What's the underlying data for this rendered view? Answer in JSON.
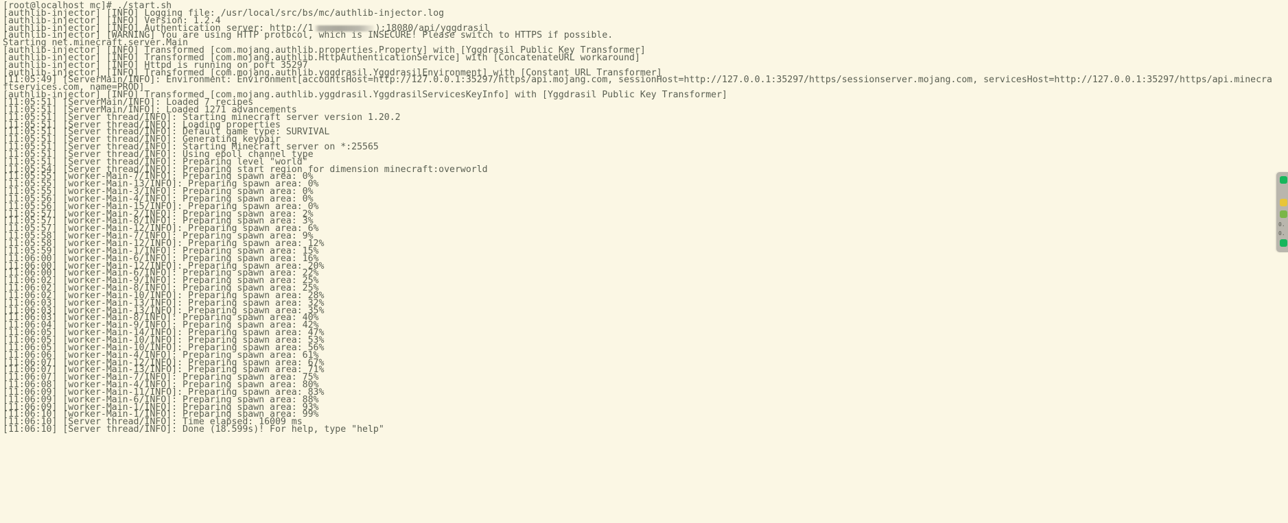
{
  "terminal": {
    "background_color": "#fbf7e4",
    "text_color": "#5a5f52",
    "prompt": "[root@localhost mc]# ./start.sh",
    "lines": [
      "[root@localhost mc]# ./start.sh",
      "[authlib-injector] [INFO] Logging file: /usr/local/src/bs/mc/authlib-injector.log",
      "[authlib-injector] [INFO] Version: 1.2.4",
      "__REDACTED_AUTH_LINE__",
      "[authlib-injector] [WARNING] You are using HTTP protocol, which is INSECURE! Please switch to HTTPS if possible.",
      "Starting net.minecraft.server.Main",
      "[authlib-injector] [INFO] Transformed [com.mojang.authlib.properties.Property] with [Yggdrasil Public Key Transformer]",
      "[authlib-injector] [INFO] Transformed [com.mojang.authlib.HttpAuthenticationService] with [ConcatenateURL workaround]",
      "[authlib-injector] [INFO] Httpd is running on port 35297",
      "[authlib-injector] [INFO] Transformed [com.mojang.authlib.yggdrasil.YggdrasilEnvironment] with [Constant URL Transformer]",
      "[11:05:49] [ServerMain/INFO]: Environment: Environment[accountsHost=http://127.0.0.1:35297/https/api.mojang.com, sessionHost=http://127.0.0.1:35297/https/sessionserver.mojang.com, servicesHost=http://127.0.0.1:35297/https/api.minecra",
      "ftservices.com, name=PROD]",
      "[authlib-injector] [INFO] Transformed [com.mojang.authlib.yggdrasil.YggdrasilServicesKeyInfo] with [Yggdrasil Public Key Transformer]",
      "[11:05:51] [ServerMain/INFO]: Loaded 7 recipes",
      "[11:05:51] [ServerMain/INFO]: Loaded 1271 advancements",
      "[11:05:51] [Server thread/INFO]: Starting minecraft server version 1.20.2",
      "[11:05:51] [Server thread/INFO]: Loading properties",
      "[11:05:51] [Server thread/INFO]: Default game type: SURVIVAL",
      "[11:05:51] [Server thread/INFO]: Generating keypair",
      "[11:05:51] [Server thread/INFO]: Starting Minecraft server on *:25565",
      "[11:05:51] [Server thread/INFO]: Using epoll channel type",
      "[11:05:51] [Server thread/INFO]: Preparing level \"world\"",
      "[11:05:54] [Server thread/INFO]: Preparing start region for dimension minecraft:overworld",
      "[11:05:55] [worker-Main-7/INFO]: Preparing spawn area: 0%",
      "[11:05:55] [worker-Main-13/INFO]: Preparing spawn area: 0%",
      "[11:05:55] [worker-Main-3/INFO]: Preparing spawn area: 0%",
      "[11:05:56] [worker-Main-4/INFO]: Preparing spawn area: 0%",
      "[11:05:56] [worker-Main-15/INFO]: Preparing spawn area: 0%",
      "[11:05:57] [worker-Main-2/INFO]: Preparing spawn area: 2%",
      "[11:05:57] [worker-Main-8/INFO]: Preparing spawn area: 3%",
      "[11:05:57] [worker-Main-12/INFO]: Preparing spawn area: 6%",
      "[11:05:58] [worker-Main-7/INFO]: Preparing spawn area: 9%",
      "[11:05:58] [worker-Main-12/INFO]: Preparing spawn area: 12%",
      "[11:05:59] [worker-Main-1/INFO]: Preparing spawn area: 15%",
      "[11:06:00] [worker-Main-6/INFO]: Preparing spawn area: 16%",
      "[11:06:00] [worker-Main-12/INFO]: Preparing spawn area: 20%",
      "[11:06:00] [worker-Main-6/INFO]: Preparing spawn area: 22%",
      "[11:06:02] [worker-Main-9/INFO]: Preparing spawn area: 25%",
      "[11:06:02] [worker-Main-8/INFO]: Preparing spawn area: 25%",
      "[11:06:02] [worker-Main-10/INFO]: Preparing spawn area: 28%",
      "[11:06:03] [worker-Main-13/INFO]: Preparing spawn area: 32%",
      "[11:06:03] [worker-Main-13/INFO]: Preparing spawn area: 35%",
      "[11:06:03] [worker-Main-8/INFO]: Preparing spawn area: 40%",
      "[11:06:04] [worker-Main-9/INFO]: Preparing spawn area: 42%",
      "[11:06:05] [worker-Main-14/INFO]: Preparing spawn area: 47%",
      "[11:06:05] [worker-Main-10/INFO]: Preparing spawn area: 53%",
      "[11:06:05] [worker-Main-10/INFO]: Preparing spawn area: 56%",
      "[11:06:06] [worker-Main-4/INFO]: Preparing spawn area: 61%",
      "[11:06:07] [worker-Main-12/INFO]: Preparing spawn area: 67%",
      "[11:06:07] [worker-Main-13/INFO]: Preparing spawn area: 71%",
      "[11:06:07] [worker-Main-7/INFO]: Preparing spawn area: 75%",
      "[11:06:08] [worker-Main-4/INFO]: Preparing spawn area: 80%",
      "[11:06:09] [worker-Main-11/INFO]: Preparing spawn area: 83%",
      "[11:06:09] [worker-Main-6/INFO]: Preparing spawn area: 88%",
      "[11:06:09] [worker-Main-1/INFO]: Preparing spawn area: 93%",
      "[11:06:10] [worker-Main-1/INFO]: Preparing spawn area: 99%",
      "[11:06:10] [Server thread/INFO]: Time elapsed: 16009 ms",
      "[11:06:10] [Server thread/INFO]: Done (18.599s)! For help, type \"help\""
    ],
    "redacted_line": {
      "prefix": "[authlib-injector] [INFO] Authentication server: http://1",
      "suffix": "):18080/api/yggdrasil",
      "note": "redacted-ip-block"
    }
  },
  "edge_widget": {
    "label_1": "0.",
    "label_2": "0.",
    "dot_colors": [
      "#17b65c",
      "#e8c53a",
      "#7ab648",
      "#17b65c"
    ]
  }
}
